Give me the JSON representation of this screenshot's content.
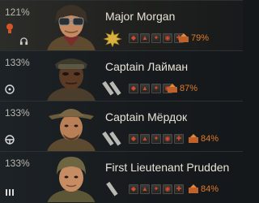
{
  "crew": [
    {
      "skill_percent": "121%",
      "name": "Major Morgan",
      "role": "commander",
      "rank": "major",
      "skill_icons": [
        "repair",
        "camouflage",
        "firefighting",
        "recon",
        "brothers-in-arms"
      ],
      "training_percent": "79%",
      "active": true
    },
    {
      "skill_percent": "133%",
      "name": "Captain Лайман",
      "role": "gunner",
      "rank": "captain",
      "skill_icons": [
        "repair",
        "camouflage",
        "firefighting",
        "deadeye"
      ],
      "training_percent": "87%",
      "active": false
    },
    {
      "skill_percent": "133%",
      "name": "Captain Мёрдок",
      "role": "driver",
      "rank": "captain",
      "skill_icons": [
        "repair",
        "camouflage",
        "firefighting",
        "smooth-ride",
        "clutch-braking"
      ],
      "training_percent": "84%",
      "active": false
    },
    {
      "skill_percent": "133%",
      "name": "First Lieutenant Prudden",
      "role": "loader",
      "rank": "first-lieutenant",
      "skill_icons": [
        "repair",
        "camouflage",
        "firefighting",
        "safe-stowage",
        "adrenaline"
      ],
      "training_percent": "84%",
      "active": false
    }
  ],
  "colors": {
    "training_percent": "#e07a2a",
    "skill_glyph": "#d34a2a",
    "name_text": "#e8e3d6",
    "rank_gold": "#d8b23c"
  }
}
